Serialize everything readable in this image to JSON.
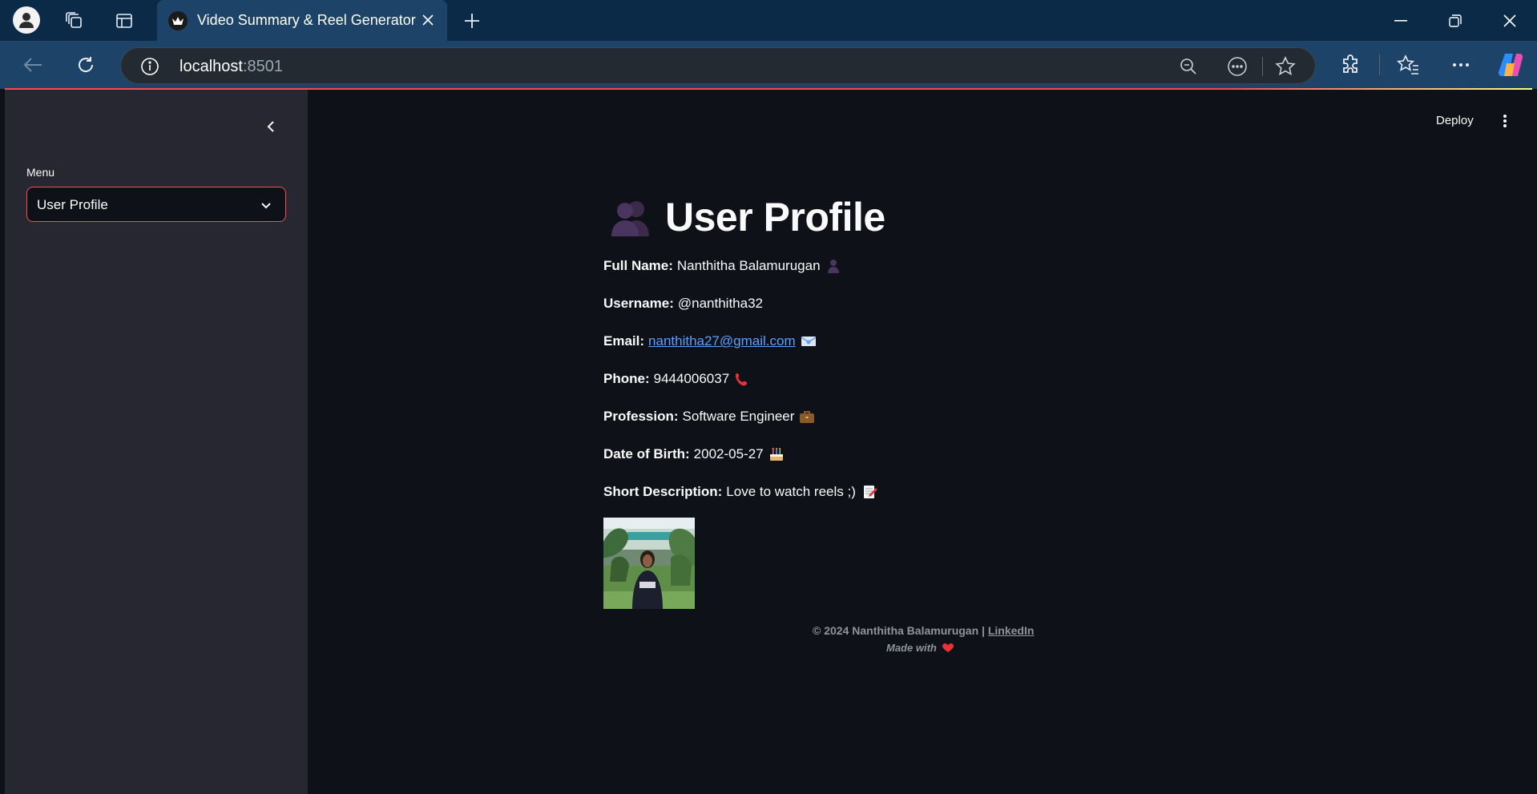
{
  "browser": {
    "tab_title": "Video Summary & Reel Generator",
    "url_host": "localhost",
    "url_port": ":8501"
  },
  "sidebar": {
    "menu_label": "Menu",
    "selected_option": "User Profile"
  },
  "header": {
    "deploy_label": "Deploy"
  },
  "profile": {
    "title": "User Profile",
    "fields": [
      {
        "label": "Full Name:",
        "value": "Nanthitha Balamurugan",
        "icon": "person-icon"
      },
      {
        "label": "Username:",
        "value": "@nanthitha32",
        "icon": ""
      },
      {
        "label": "Email:",
        "value": "nanthitha27@gmail.com",
        "icon": "envelope-icon"
      },
      {
        "label": "Phone:",
        "value": "9444006037",
        "icon": "phone-icon"
      },
      {
        "label": "Profession:",
        "value": "Software Engineer",
        "icon": "briefcase-icon"
      },
      {
        "label": "Date of Birth:",
        "value": "2002-05-27",
        "icon": "cake-icon"
      },
      {
        "label": "Short Description:",
        "value": "Love to watch reels ;)",
        "icon": "memo-icon"
      }
    ]
  },
  "footer": {
    "copyright": "© 2024 Nanthitha Balamurugan |",
    "link": "LinkedIn",
    "made_with": "Made with"
  },
  "colors": {
    "accent": "#ff4b4b",
    "sidebar_bg": "#262730",
    "main_bg": "#0e1117",
    "link": "#5aa0ff"
  }
}
